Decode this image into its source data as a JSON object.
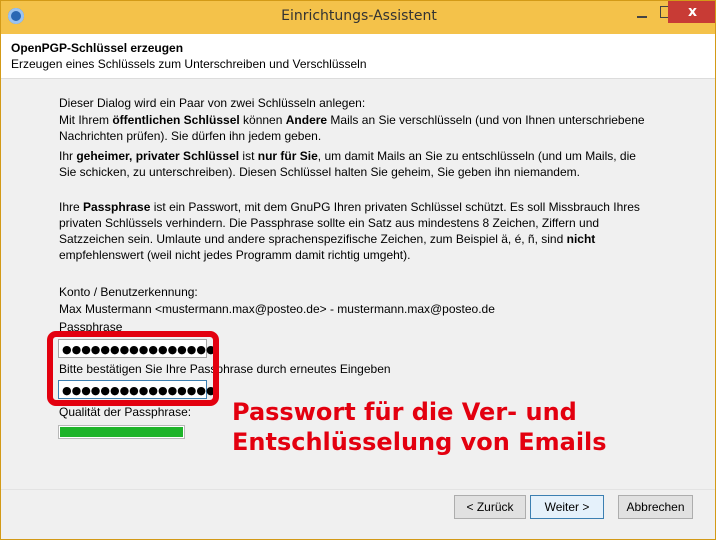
{
  "window": {
    "title": "Einrichtungs-Assistent",
    "close_glyph": "x"
  },
  "header": {
    "title": "OpenPGP-Schlüssel erzeugen",
    "subtitle": "Erzeugen eines Schlüssels zum Unterschreiben und Verschlüsseln"
  },
  "intro": {
    "line1": "Dieser Dialog wird ein Paar von zwei Schlüsseln anlegen:",
    "public_p1": "Mit Ihrem ",
    "public_b1": "öffentlichen Schlüssel",
    "public_p2": " können ",
    "public_b2": "Andere",
    "public_p3": " Mails an Sie verschlüsseln (und von Ihnen unterschriebene Nachrichten prüfen). Sie dürfen ihn jedem geben.",
    "private_p1": "Ihr ",
    "private_b1": "geheimer, privater Schlüssel",
    "private_p2": " ist ",
    "private_b2": "nur für Sie",
    "private_p3": ", um damit Mails an Sie zu entschlüsseln (und um Mails, die Sie schicken, zu unterschreiben). Diesen Schlüssel halten Sie geheim, Sie geben ihn niemandem.",
    "pass_p1": "Ihre ",
    "pass_b1": "Passphrase",
    "pass_p2": " ist ein Passwort, mit dem GnuPG Ihren privaten Schlüssel schützt. Es soll Missbrauch Ihres privaten Schlüssels verhindern. Die Passphrase sollte ein Satz aus mindestens 8 Zeichen, Ziffern und Satzzeichen sein. Umlaute und andere sprachenspezifische Zeichen, zum Beispiel ä, é, ñ, sind ",
    "pass_b2": "nicht",
    "pass_p3": " empfehlenswert (weil nicht jedes Programm damit richtig umgeht)."
  },
  "account": {
    "label": "Konto / Benutzerkennung:",
    "value": "Max Mustermann <mustermann.max@posteo.de> - mustermann.max@posteo.de"
  },
  "passphrase": {
    "label": "Passphrase",
    "value": "●●●●●●●●●●●●●●●●",
    "confirm_label": "Bitte bestätigen Sie Ihre Passphrase durch erneutes Eingeben",
    "confirm_value": "●●●●●●●●●●●●●●●●",
    "quality_label": "Qualität der Passphrase:",
    "quality_level": 1.0
  },
  "annotation": {
    "line1": "Passwort für die Ver- und",
    "line2": "Entschlüsselung von Emails",
    "color": "#e3000f"
  },
  "buttons": {
    "back": "< Zurück",
    "next": "Weiter >",
    "cancel": "Abbrechen"
  }
}
